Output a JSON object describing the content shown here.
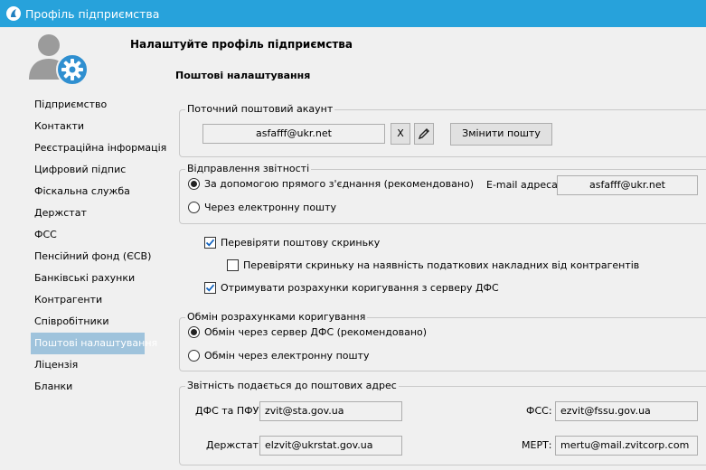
{
  "window": {
    "title": "Профіль підприємства"
  },
  "header": {
    "title": "Налаштуйте профіль підприємства",
    "section": "Поштові налаштування"
  },
  "sidebar": {
    "items": [
      {
        "label": "Підприємство",
        "active": false
      },
      {
        "label": "Контакти",
        "active": false
      },
      {
        "label": "Реєстраційна інформація",
        "active": false
      },
      {
        "label": "Цифровий підпис",
        "active": false
      },
      {
        "label": "Фіскальна служба",
        "active": false
      },
      {
        "label": "Держстат",
        "active": false
      },
      {
        "label": "ФСС",
        "active": false
      },
      {
        "label": "Пенсійний фонд (ЄСВ)",
        "active": false
      },
      {
        "label": "Банківські рахунки",
        "active": false
      },
      {
        "label": "Контрагенти",
        "active": false
      },
      {
        "label": "Співробітники",
        "active": false
      },
      {
        "label": "Поштові налаштування",
        "active": true
      },
      {
        "label": "Ліцензія",
        "active": false
      },
      {
        "label": "Бланки",
        "active": false
      }
    ]
  },
  "account": {
    "legend": "Поточний поштовий акаунт",
    "email": "asfafff@ukr.net",
    "clear_label": "X",
    "change_label": "Змінити пошту"
  },
  "sending": {
    "legend": "Відправлення звітності",
    "option_direct": "За допомогою прямого з'єднання (рекомендовано)",
    "option_email": "Через електронну пошту",
    "email_label": "E-mail адреса:",
    "email_value": "asfafff@ukr.net"
  },
  "checks": {
    "check_mailbox": "Перевіряти поштову скриньку",
    "check_invoices": "Перевіряти скриньку на наявність податкових накладних від контрагентів",
    "receive_adjustments": "Отримувати розрахунки коригування з серверу ДФС"
  },
  "exchange": {
    "legend": "Обмін розрахунками коригування",
    "option_server": "Обмін через сервер ДФС (рекомендовано)",
    "option_email": "Обмін через електронну пошту"
  },
  "addresses": {
    "legend": "Звітність подається до поштових адрес",
    "dfs_label": "ДФС та ПФУ:",
    "dfs_value": "zvit@sta.gov.ua",
    "fss_label": "ФСС:",
    "fss_value": "ezvit@fssu.gov.ua",
    "derzhstat_label": "Держстат:",
    "derzhstat_value": "elzvit@ukrstat.gov.ua",
    "mert_label": "МЕРТ:",
    "mert_value": "mertu@mail.zvitcorp.com"
  },
  "colors": {
    "titlebar": "#27a2db",
    "nav_active": "#9fc3dc",
    "gear": "#2f8fd0",
    "avatar": "#9b9b9b"
  },
  "icons": {
    "app": "app-logo-icon",
    "avatar": "user-gear-icon",
    "edit": "pencil-icon",
    "check": "checkmark-icon"
  }
}
